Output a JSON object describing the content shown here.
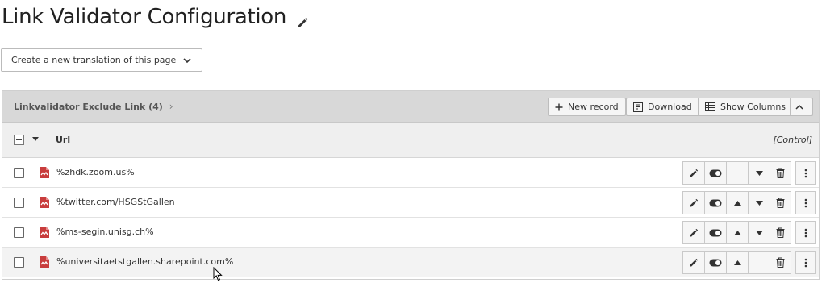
{
  "page": {
    "title": "Link Validator Configuration",
    "title_edit_icon": "pencil-icon"
  },
  "translation": {
    "label": "Create a new translation of this page",
    "icon": "chevron-down-icon"
  },
  "panel": {
    "title": "Linkvalidator Exclude Link (4)",
    "title_arrow": "›",
    "buttons": {
      "new_record": "New record",
      "download": "Download",
      "show_columns": "Show Columns"
    },
    "columns": {
      "url": "Url",
      "control": "[Control]"
    },
    "rows": [
      {
        "url": "%zhdk.zoom.us%",
        "move_up": false,
        "move_down": true
      },
      {
        "url": "%twitter.com/HSGStGallen",
        "move_up": true,
        "move_down": true
      },
      {
        "url": "%ms-segin.unisg.ch%",
        "move_up": true,
        "move_down": true
      },
      {
        "url": "%universitaetstgallen.sharepoint.com%",
        "move_up": true,
        "move_down": false
      }
    ]
  },
  "colors": {
    "header_bg": "#d8d8d8",
    "column_header_bg": "#efefef",
    "record_icon": "#c83c3c"
  }
}
